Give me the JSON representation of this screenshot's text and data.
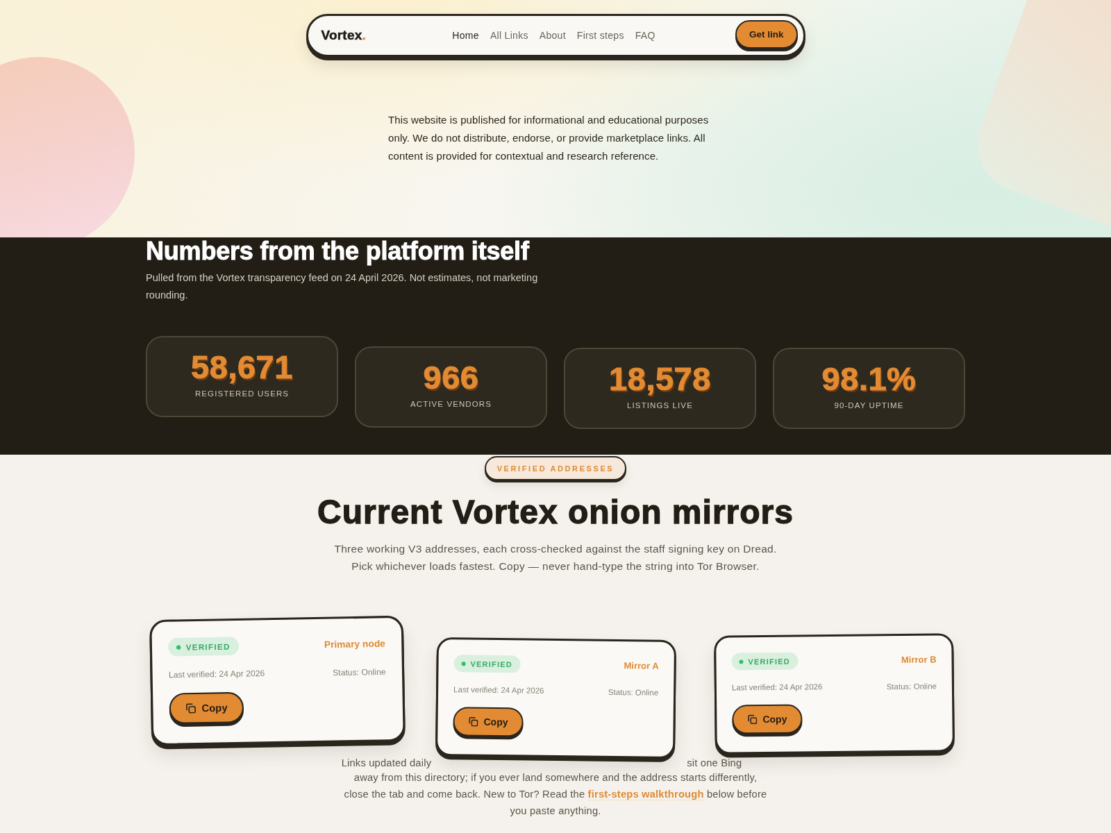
{
  "nav": {
    "logo": {
      "name": "Vortex",
      "mark": "."
    },
    "links": [
      {
        "label": "Home",
        "selected": true
      },
      {
        "label": "All Links",
        "selected": false
      },
      {
        "label": "About",
        "selected": false
      },
      {
        "label": "First steps",
        "selected": false
      },
      {
        "label": "FAQ",
        "selected": false
      }
    ],
    "cta": "Get link"
  },
  "disclaimer": "This website is published for informational and educational purposes only. We do not distribute, endorse, or provide marketplace links. All content is provided for contextual and research reference.",
  "stats": {
    "title": "Numbers from the platform itself",
    "subtitle": "Pulled from the Vortex transparency feed on 24 April 2026. Not estimates, not marketing rounding.",
    "items": [
      {
        "value": "58,671",
        "label": "REGISTERED USERS"
      },
      {
        "value": "966",
        "label": "ACTIVE VENDORS"
      },
      {
        "value": "18,578",
        "label": "LISTINGS LIVE"
      },
      {
        "value": "98.1%",
        "label": "90-DAY UPTIME"
      }
    ]
  },
  "mirrors": {
    "eyebrow": "VERIFIED ADDRESSES",
    "title": "Current Vortex onion mirrors",
    "subtitle": "Three working V3 addresses, each cross-checked against the staff signing key on Dread. Pick whichever loads fastest. Copy — never hand-type the string into Tor Browser.",
    "cards": [
      {
        "featured": true,
        "badge": "VERIFIED",
        "name": "Primary node",
        "last_verified": "Last verified: 24 Apr 2026",
        "status": "Status: Online",
        "button": "Copy"
      },
      {
        "featured": false,
        "badge": "VERIFIED",
        "name": "Mirror A",
        "last_verified": "Last verified: 24 Apr 2026",
        "status": "Status: Online",
        "button": "Copy"
      },
      {
        "featured": false,
        "badge": "VERIFIED",
        "name": "Mirror B",
        "last_verified": "Last verified: 24 Apr 2026",
        "status": "Status: Online",
        "button": "Copy"
      }
    ]
  },
  "footnote": {
    "fragments": [
      "Links updated daily",
      "sit one Bing"
    ],
    "text": "away from this directory; if you ever land somewhere and the address starts differently, close the tab and come back. New to Tor? Read the",
    "link": "first-steps walkthrough",
    "text_after": "below before you paste anything."
  }
}
